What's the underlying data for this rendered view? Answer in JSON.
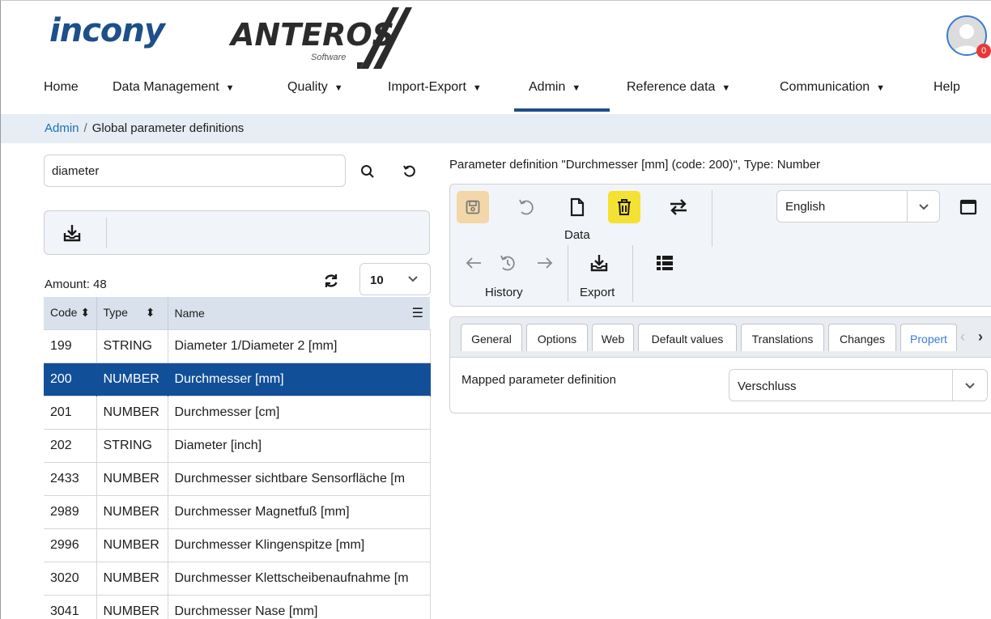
{
  "header": {
    "logo_main": "incony",
    "logo_secondary": "ANTEROS",
    "logo_secondary_sub": "Software",
    "notification_count": "0"
  },
  "nav": {
    "items": [
      {
        "label": "Home"
      },
      {
        "label": "Data Management"
      },
      {
        "label": "Quality"
      },
      {
        "label": "Import-Export"
      },
      {
        "label": "Admin"
      },
      {
        "label": "Reference data"
      },
      {
        "label": "Communication"
      },
      {
        "label": "Help"
      }
    ],
    "active": "Admin"
  },
  "breadcrumb": {
    "root": "Admin",
    "separator": "/",
    "current": "Global parameter definitions"
  },
  "left": {
    "search_value": "diameter",
    "amount_label": "Amount: 48",
    "page_size": "10",
    "columns": [
      "Code",
      "Type",
      "Name"
    ],
    "rows": [
      {
        "code": "199",
        "type": "STRING",
        "name": "Diameter 1/Diameter 2 [mm]"
      },
      {
        "code": "200",
        "type": "NUMBER",
        "name": "Durchmesser [mm]"
      },
      {
        "code": "201",
        "type": "NUMBER",
        "name": "Durchmesser [cm]"
      },
      {
        "code": "202",
        "type": "STRING",
        "name": "Diameter [inch]"
      },
      {
        "code": "2433",
        "type": "NUMBER",
        "name": "Durchmesser sichtbare Sensorfläche [m"
      },
      {
        "code": "2989",
        "type": "NUMBER",
        "name": "Durchmesser Magnetfuß [mm]"
      },
      {
        "code": "2996",
        "type": "NUMBER",
        "name": "Durchmesser Klingenspitze [mm]"
      },
      {
        "code": "3020",
        "type": "NUMBER",
        "name": "Durchmesser Klettscheibenaufnahme [m"
      },
      {
        "code": "3041",
        "type": "NUMBER",
        "name": "Durchmesser Nase [mm]"
      }
    ],
    "selected_code": "200"
  },
  "right": {
    "title": "Parameter definition \"Durchmesser [mm] (code: 200)\", Type: Number",
    "toolbar": {
      "data_label": "Data",
      "history_label": "History",
      "export_label": "Export"
    },
    "language": "English",
    "tabs": [
      "General",
      "Options",
      "Web",
      "Default values",
      "Translations",
      "Changes",
      "Propert"
    ],
    "active_tab": "Propert",
    "mapped_label": "Mapped parameter definition",
    "mapped_value": "Verschluss"
  },
  "colors": {
    "brand": "#1d4f8a",
    "selected_row": "#124f99",
    "breadcrumb_bg": "#e6edf4",
    "save_btn": "#f3d7a8",
    "delete_btn": "#f5e131",
    "badge": "#e53935"
  }
}
